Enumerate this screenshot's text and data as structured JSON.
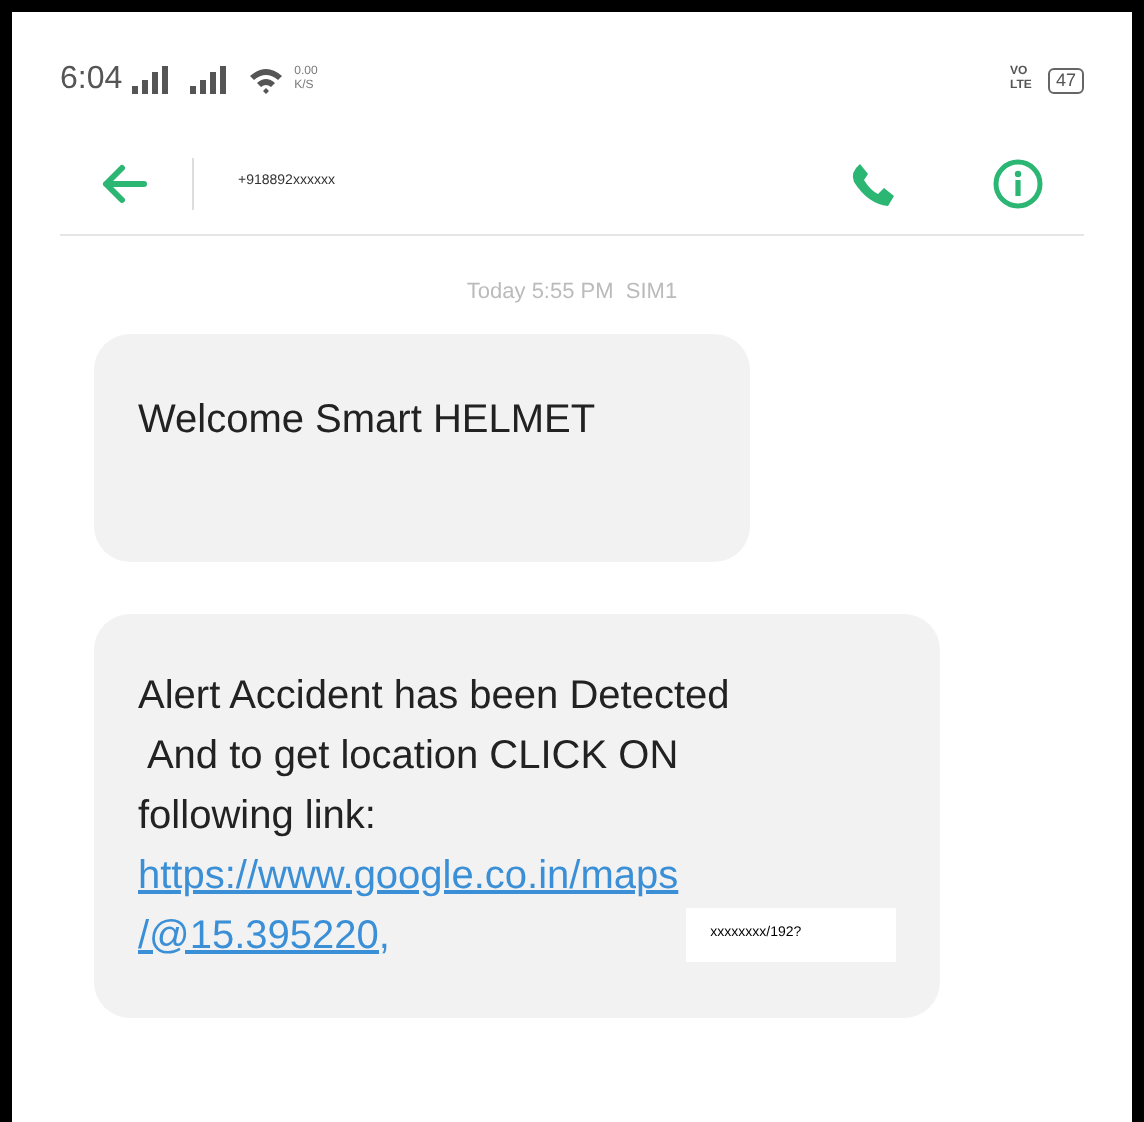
{
  "status_bar": {
    "time": "6:04",
    "speed": "0.00 K/S",
    "network": "VO LTE",
    "battery": "47"
  },
  "header": {
    "contact": "+918892xxxxxx"
  },
  "timestamp": "Today 5:55 PM  SIM1",
  "messages": [
    {
      "text": "Welcome Smart HELMET"
    },
    {
      "text": "Alert Accident has been Detected\n And to get location CLICK ON\nfollowing link:",
      "link": "https://www.google.co.in/maps\n/@15.395220,",
      "redacted": "xxxxxxxx/192?"
    }
  ]
}
